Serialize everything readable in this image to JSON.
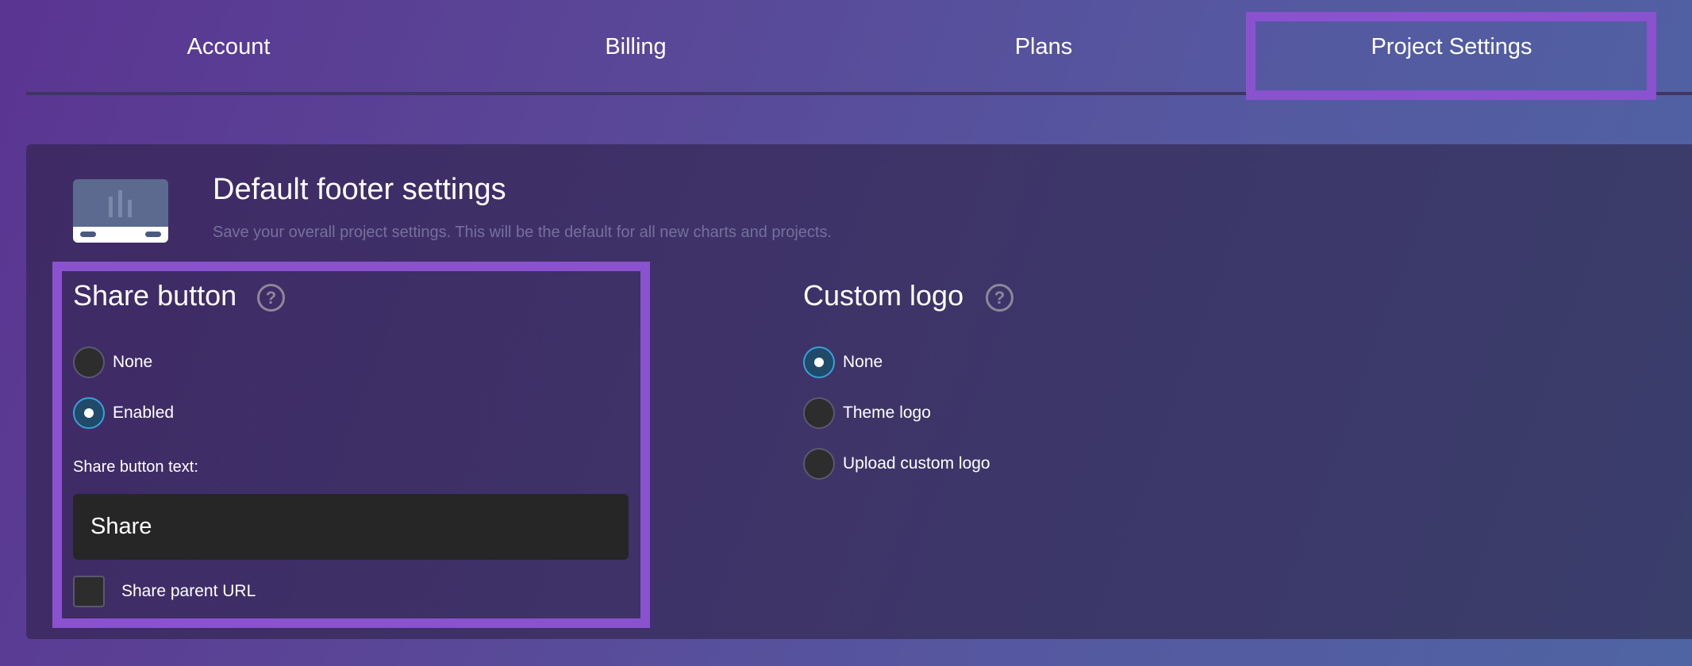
{
  "tabs": [
    {
      "label": "Account"
    },
    {
      "label": "Billing"
    },
    {
      "label": "Plans"
    },
    {
      "label": "Project Settings",
      "selected": true
    }
  ],
  "card": {
    "title": "Default footer settings",
    "subtitle": "Save your overall project settings. This will be the default for all new charts and projects."
  },
  "share": {
    "title": "Share button",
    "options": [
      {
        "label": "None",
        "checked": false
      },
      {
        "label": "Enabled",
        "checked": true
      }
    ],
    "text_label": "Share button text:",
    "text_value": "Share",
    "parent_url_label": "Share parent URL",
    "parent_url_checked": false
  },
  "logo": {
    "title": "Custom logo",
    "options": [
      {
        "label": "None",
        "checked": true
      },
      {
        "label": "Theme logo",
        "checked": false
      },
      {
        "label": "Upload custom logo",
        "checked": false
      }
    ]
  },
  "help_glyph": "?",
  "colors": {
    "highlight": "#8a52cf",
    "radio_checked_border": "#3aa0d8",
    "subtitle": "#75709c"
  }
}
